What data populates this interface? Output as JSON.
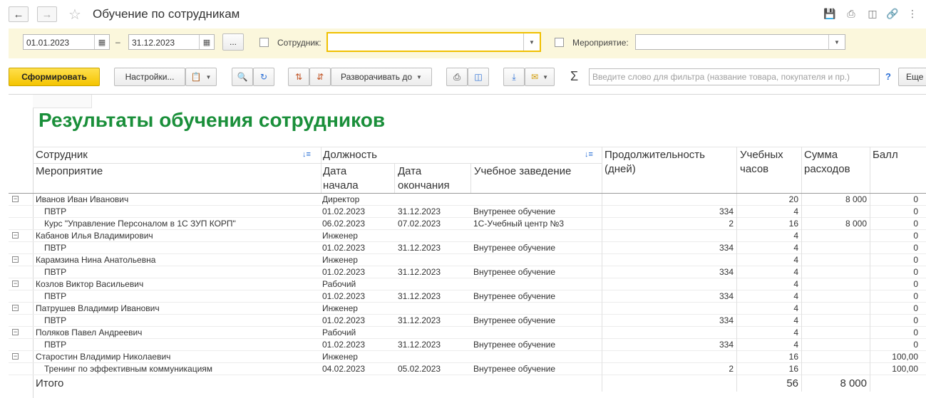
{
  "window": {
    "title": "Обучение по сотрудникам"
  },
  "filters": {
    "date_from": "01.01.2023",
    "date_dash": "–",
    "date_to": "31.12.2023",
    "ellipsis": "...",
    "employee_label": "Сотрудник:",
    "employee_value": "",
    "event_label": "Мероприятие:",
    "event_value": ""
  },
  "toolbar": {
    "generate": "Сформировать",
    "settings": "Настройки...",
    "expand_to": "Разворачивать до",
    "search_placeholder": "Введите слово для фильтра (название товара, покупателя и пр.)",
    "help": "?",
    "more": "Еще"
  },
  "report": {
    "title": "Результаты обучения сотрудников",
    "headers": {
      "employee": "Сотрудник",
      "event": "Мероприятие",
      "position": "Должность",
      "start_date_1": "Дата",
      "start_date_2": "начала",
      "end_date_1": "Дата",
      "end_date_2": "окончания",
      "institution": "Учебное заведение",
      "duration_1": "Продолжительность",
      "duration_2": "(дней)",
      "hours_1": "Учебных",
      "hours_2": "часов",
      "cost_1": "Сумма",
      "cost_2": "расходов",
      "score": "Балл"
    },
    "rows": [
      {
        "group": true,
        "name": "Иванов Иван Иванович",
        "position": "Директор",
        "start": "",
        "end": "",
        "inst": "",
        "dur": "",
        "hours": "20",
        "cost": "8 000",
        "score": "0"
      },
      {
        "group": false,
        "name": "ПВТР",
        "position": "",
        "start": "01.02.2023",
        "end": "31.12.2023",
        "inst": "Внутренее обучение",
        "dur": "334",
        "hours": "4",
        "cost": "",
        "score": "0"
      },
      {
        "group": false,
        "name": "Курс \"Управление Персоналом в 1С ЗУП КОРП\"",
        "position": "",
        "start": "06.02.2023",
        "end": "07.02.2023",
        "inst": "1С-Учебный центр №3",
        "dur": "2",
        "hours": "16",
        "cost": "8 000",
        "score": "0"
      },
      {
        "group": true,
        "name": "Кабанов Илья Владимирович",
        "position": "Инженер",
        "start": "",
        "end": "",
        "inst": "",
        "dur": "",
        "hours": "4",
        "cost": "",
        "score": "0"
      },
      {
        "group": false,
        "name": "ПВТР",
        "position": "",
        "start": "01.02.2023",
        "end": "31.12.2023",
        "inst": "Внутренее обучение",
        "dur": "334",
        "hours": "4",
        "cost": "",
        "score": "0"
      },
      {
        "group": true,
        "name": "Карамзина Нина Анатольевна",
        "position": "Инженер",
        "start": "",
        "end": "",
        "inst": "",
        "dur": "",
        "hours": "4",
        "cost": "",
        "score": "0"
      },
      {
        "group": false,
        "name": "ПВТР",
        "position": "",
        "start": "01.02.2023",
        "end": "31.12.2023",
        "inst": "Внутренее обучение",
        "dur": "334",
        "hours": "4",
        "cost": "",
        "score": "0"
      },
      {
        "group": true,
        "name": "Козлов Виктор Васильевич",
        "position": "Рабочий",
        "start": "",
        "end": "",
        "inst": "",
        "dur": "",
        "hours": "4",
        "cost": "",
        "score": "0"
      },
      {
        "group": false,
        "name": "ПВТР",
        "position": "",
        "start": "01.02.2023",
        "end": "31.12.2023",
        "inst": "Внутренее обучение",
        "dur": "334",
        "hours": "4",
        "cost": "",
        "score": "0"
      },
      {
        "group": true,
        "name": "Патрушев Владимир Иванович",
        "position": "Инженер",
        "start": "",
        "end": "",
        "inst": "",
        "dur": "",
        "hours": "4",
        "cost": "",
        "score": "0"
      },
      {
        "group": false,
        "name": "ПВТР",
        "position": "",
        "start": "01.02.2023",
        "end": "31.12.2023",
        "inst": "Внутренее обучение",
        "dur": "334",
        "hours": "4",
        "cost": "",
        "score": "0"
      },
      {
        "group": true,
        "name": "Поляков Павел Андреевич",
        "position": "Рабочий",
        "start": "",
        "end": "",
        "inst": "",
        "dur": "",
        "hours": "4",
        "cost": "",
        "score": "0"
      },
      {
        "group": false,
        "name": "ПВТР",
        "position": "",
        "start": "01.02.2023",
        "end": "31.12.2023",
        "inst": "Внутренее обучение",
        "dur": "334",
        "hours": "4",
        "cost": "",
        "score": "0"
      },
      {
        "group": true,
        "name": "Старостин Владимир Николаевич",
        "position": "Инженер",
        "start": "",
        "end": "",
        "inst": "",
        "dur": "",
        "hours": "16",
        "cost": "",
        "score": "100,00"
      },
      {
        "group": false,
        "name": "Тренинг по эффективным коммуникациям",
        "position": "",
        "start": "04.02.2023",
        "end": "05.02.2023",
        "inst": "Внутренее обучение",
        "dur": "2",
        "hours": "16",
        "cost": "",
        "score": "100,00"
      }
    ],
    "total": {
      "label": "Итого",
      "hours": "56",
      "cost": "8 000"
    }
  }
}
